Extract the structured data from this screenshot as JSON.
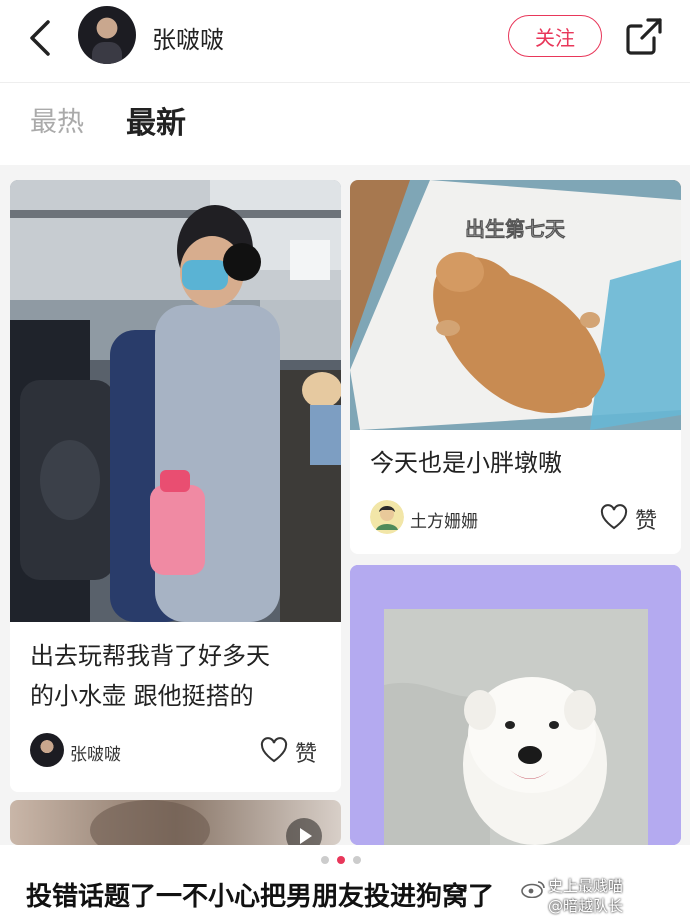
{
  "header": {
    "username": "张啵啵",
    "follow_label": "关注"
  },
  "tabs": [
    {
      "label": "最热",
      "active": false
    },
    {
      "label": "最新",
      "active": true
    }
  ],
  "cards": [
    {
      "title_line1": "出去玩帮我背了好多天",
      "title_line2": "的小水壶 跟他挺搭的",
      "author": "张啵啵",
      "like_label": "赞"
    },
    {
      "photo_text": "出生第七天",
      "title": "今天也是小胖墩嗷",
      "author": "土方姗姗",
      "like_label": "赞"
    },
    {
      "title": ""
    }
  ],
  "caption": "投错话题了一不小心把男朋友投进狗窝了",
  "watermark": {
    "line1": "史上最贱喵",
    "line2": "@暗越队长"
  },
  "pagination": {
    "total": 3,
    "current": 2
  },
  "colors": {
    "accent": "#e8375a",
    "card_bg_purple": "#b4aaf0"
  }
}
